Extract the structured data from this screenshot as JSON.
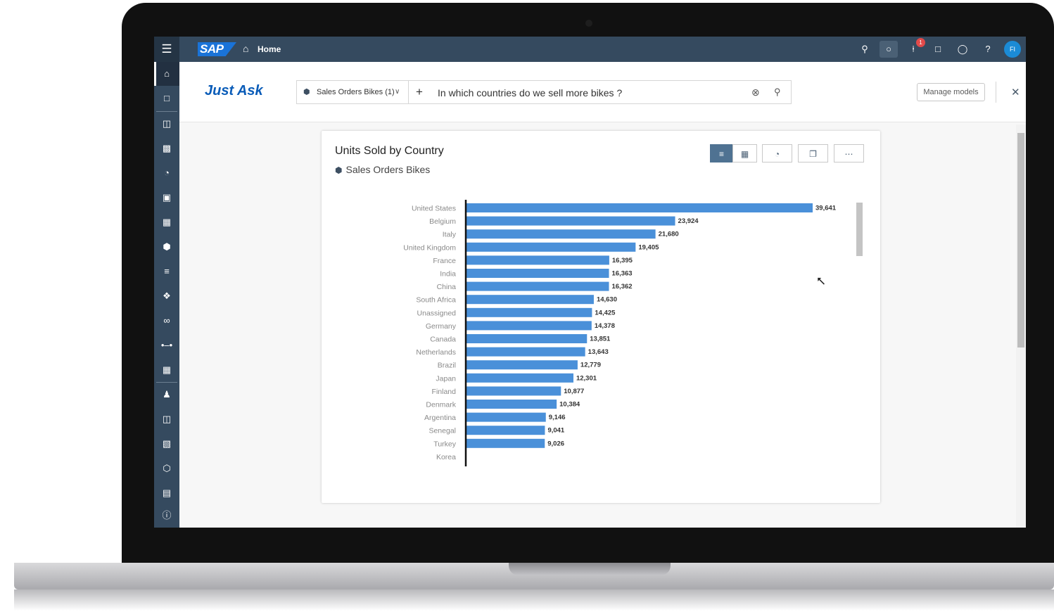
{
  "shell": {
    "logo": "SAP",
    "home_label": "Home",
    "notification_count": "1",
    "avatar_initials": "FI",
    "icons": [
      "search-icon",
      "lightbulb-icon",
      "bell-icon",
      "feedback-icon",
      "chat-icon",
      "help-icon"
    ]
  },
  "nav": {
    "icons": [
      "home-icon",
      "files-icon",
      "stories-icon",
      "analytic-app-icon",
      "digital-boardroom-icon",
      "data-analyzer-icon",
      "modeler-icon",
      "model-icon",
      "data-action-icon",
      "multi-action-icon",
      "explorer-icon",
      "connections-icon",
      "calendar-icon",
      "users-icon",
      "catalog-icon",
      "security-icon",
      "deployment-icon",
      "content-network-icon",
      "info-icon"
    ]
  },
  "header": {
    "title": "Just Ask",
    "model_selector": "Sales Orders Bikes (1)",
    "query": "In which countries do we sell more bikes ?",
    "manage_models": "Manage models"
  },
  "card": {
    "title": "Units Sold by Country",
    "subtitle": "Sales Orders Bikes",
    "toolbar": [
      "bar-chart-icon",
      "table-icon",
      "chart-type-icon",
      "copy-icon",
      "more-icon"
    ]
  },
  "chart_data": {
    "type": "bar",
    "orientation": "horizontal",
    "categories": [
      "United States",
      "Belgium",
      "Italy",
      "United Kingdom",
      "France",
      "India",
      "China",
      "South Africa",
      "Unassigned",
      "Germany",
      "Canada",
      "Netherlands",
      "Brazil",
      "Japan",
      "Finland",
      "Denmark",
      "Argentina",
      "Senegal",
      "Turkey",
      "Korea"
    ],
    "values": [
      39641,
      23924,
      21680,
      19405,
      16395,
      16363,
      16362,
      14630,
      14425,
      14378,
      13851,
      13643,
      12779,
      12301,
      10877,
      10384,
      9146,
      9041,
      9026,
      null
    ],
    "value_labels": [
      "39,641",
      "23,924",
      "21,680",
      "19,405",
      "16,395",
      "16,363",
      "16,362",
      "14,630",
      "14,425",
      "14,378",
      "13,851",
      "13,643",
      "12,779",
      "12,301",
      "10,877",
      "10,384",
      "9,146",
      "9,041",
      "9,026",
      ""
    ],
    "title": "Units Sold by Country",
    "xlabel": "",
    "ylabel": "",
    "bar_color": "#4a90d9",
    "grid": false
  }
}
